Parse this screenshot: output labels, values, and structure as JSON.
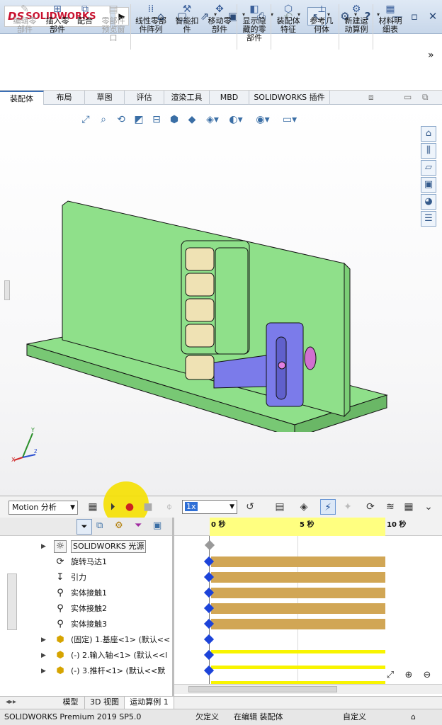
{
  "app": {
    "name": "SOLIDWORKS",
    "logo_prefix": "DS"
  },
  "quick_access": [
    "home-icon",
    "new-file-icon",
    "open-icon",
    "save-icon",
    "print-icon",
    "undo-icon",
    "select-icon",
    "options-icon",
    "help-icon"
  ],
  "command_manager": {
    "buttons": [
      {
        "label": "编辑零\n部件",
        "enabled": false
      },
      {
        "label": "插入零\n部件",
        "enabled": true
      },
      {
        "label": "配合",
        "enabled": true
      },
      {
        "label": "零部件\n预览窗\n口",
        "enabled": false
      },
      {
        "label": "线性零部\n件阵列",
        "enabled": true
      },
      {
        "label": "智能扣\n件",
        "enabled": true
      },
      {
        "label": "移动零\n部件",
        "enabled": true
      },
      {
        "label": "显示隐\n藏的零\n部件",
        "enabled": true
      },
      {
        "label": "装配体\n特征",
        "enabled": true
      },
      {
        "label": "参考几\n何体",
        "enabled": true
      },
      {
        "label": "新建运\n动算例",
        "enabled": true
      },
      {
        "label": "材料明\n细表",
        "enabled": true
      }
    ],
    "more": "»"
  },
  "tabs": [
    "装配体",
    "布局",
    "草图",
    "评估",
    "渲染工具",
    "MBD",
    "SOLIDWORKS 插件"
  ],
  "active_tab": "装配体",
  "motion": {
    "study_type": "Motion 分析",
    "speed": "1x",
    "timeline_ticks": [
      "0 秒",
      "5 秒",
      "10 秒"
    ]
  },
  "tree": [
    {
      "label": "SOLIDWORKS 光源",
      "icon": "light-icon",
      "expander": "▶"
    },
    {
      "label": "旋转马达1",
      "icon": "motor-icon",
      "expander": ""
    },
    {
      "label": "引力",
      "icon": "gravity-icon",
      "expander": ""
    },
    {
      "label": "实体接触1",
      "icon": "contact-icon",
      "expander": ""
    },
    {
      "label": "实体接触2",
      "icon": "contact-icon",
      "expander": ""
    },
    {
      "label": "实体接触3",
      "icon": "contact-icon",
      "expander": ""
    },
    {
      "label": "(固定) 1.基座<1> (默认<<",
      "icon": "part-icon",
      "expander": "▶"
    },
    {
      "label": "(-) 2.输入轴<1> (默认<<l",
      "icon": "part-icon",
      "expander": "▶"
    },
    {
      "label": "(-) 3.推杆<1> (默认<<默",
      "icon": "part-icon",
      "expander": "▶"
    }
  ],
  "bottom_tabs": [
    "模型",
    "3D 视图",
    "运动算例 1"
  ],
  "active_bottom_tab": "运动算例 1",
  "status": {
    "version": "SOLIDWORKS Premium 2019 SP5.0",
    "definition": "欠定义",
    "editing": "在编辑 装配体",
    "units": "自定义"
  },
  "colors": {
    "base_green": "#8fe08a",
    "slider_purple": "#7b7bea",
    "roller_tan": "#efe2b4",
    "bar_gold": "#d1a655",
    "timeline_yellow": "#ffff80",
    "keyframe_blue": "#1c43d9"
  }
}
